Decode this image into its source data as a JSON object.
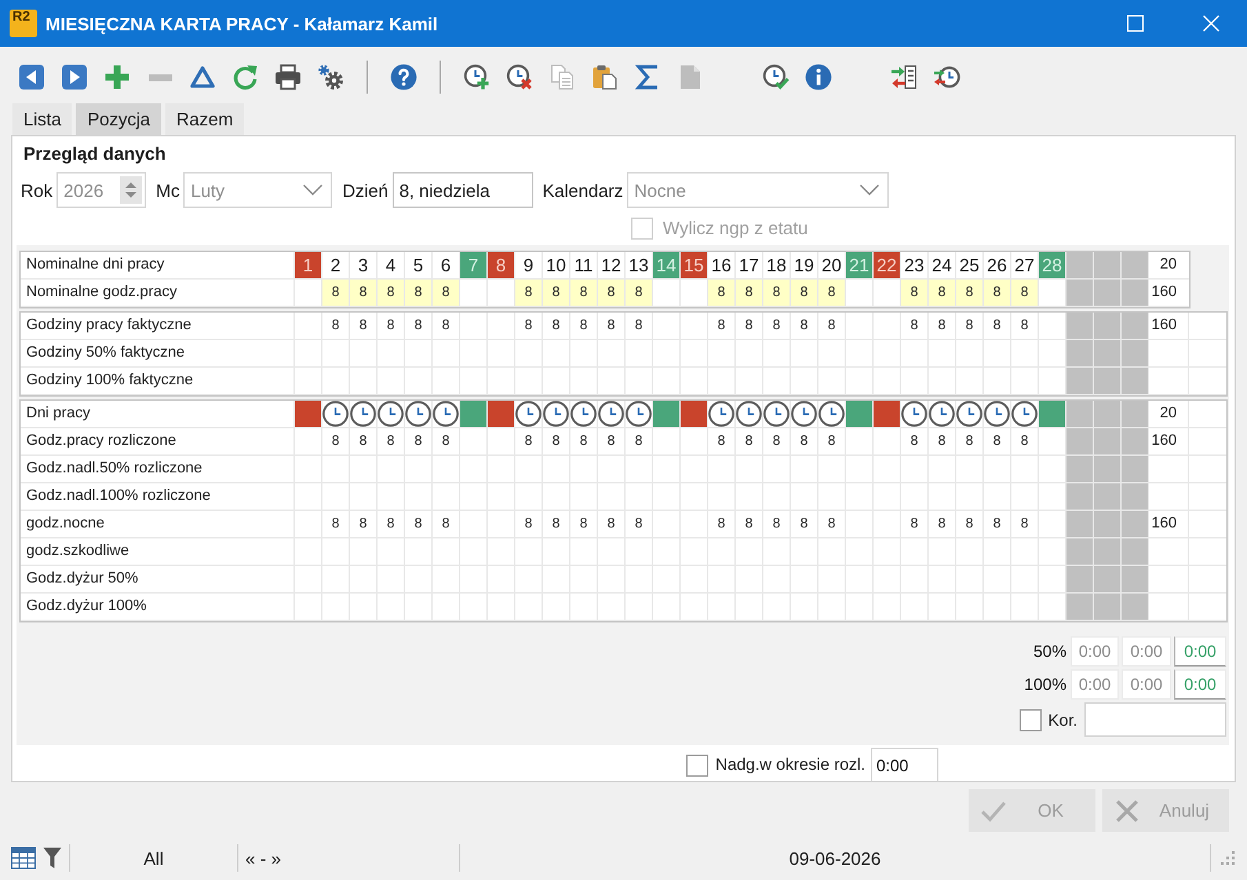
{
  "window": {
    "logo": "R2",
    "title": "MIESIĘCZNA KARTA PRACY - Kałamarz Kamil"
  },
  "toolbar": [
    {
      "disabled": false
    },
    {
      "disabled": false
    },
    {
      "disabled": false
    },
    {
      "disabled": true
    },
    {
      "disabled": false
    },
    {
      "disabled": false
    },
    {
      "disabled": false
    },
    {
      "disabled": false
    },
    {
      "disabled": false
    },
    {
      "disabled": false
    },
    {
      "disabled": false
    },
    {
      "disabled": true
    },
    {
      "disabled": false
    },
    {
      "disabled": false
    },
    {
      "disabled": true
    },
    {
      "disabled": false
    },
    {
      "disabled": false
    },
    {
      "disabled": false
    },
    {
      "disabled": false
    }
  ],
  "tabs": [
    {
      "label": "Lista",
      "selected": false
    },
    {
      "label": "Pozycja",
      "selected": true
    },
    {
      "label": "Razem",
      "selected": false
    }
  ],
  "form": {
    "title": "Przegląd danych",
    "fields": [
      {
        "kind": "spinner",
        "label": "Rok",
        "value": "2026",
        "disabled": true
      },
      {
        "kind": "dropdown",
        "label": "Mc",
        "value": "Luty",
        "disabled": true
      },
      {
        "kind": "text",
        "label": "Dzień",
        "value": "8, niedziela",
        "disabled": false
      },
      {
        "kind": "dropdown",
        "label": "Kalendarz",
        "value": "Nocne",
        "disabled": true
      }
    ],
    "checkbox": {
      "label": "Wylicz ngp z etatu",
      "checked": false,
      "disabled": true
    }
  },
  "grid": {
    "sections": [
      {
        "extra_column": false,
        "rows": [
          {
            "label": "Nominalne dni pracy",
            "kind": "days",
            "cells": [
              {
                "text": "1",
                "kind": "sunday"
              },
              {
                "text": "2",
                "kind": "work"
              },
              {
                "text": "3",
                "kind": "work"
              },
              {
                "text": "4",
                "kind": "work"
              },
              {
                "text": "5",
                "kind": "work"
              },
              {
                "text": "6",
                "kind": "work"
              },
              {
                "text": "7",
                "kind": "saturday"
              },
              {
                "text": "8",
                "kind": "sunday"
              },
              {
                "text": "9",
                "kind": "work"
              },
              {
                "text": "10",
                "kind": "work"
              },
              {
                "text": "11",
                "kind": "work"
              },
              {
                "text": "12",
                "kind": "work"
              },
              {
                "text": "13",
                "kind": "work"
              },
              {
                "text": "14",
                "kind": "saturday"
              },
              {
                "text": "15",
                "kind": "sunday"
              },
              {
                "text": "16",
                "kind": "work"
              },
              {
                "text": "17",
                "kind": "work"
              },
              {
                "text": "18",
                "kind": "work"
              },
              {
                "text": "19",
                "kind": "work"
              },
              {
                "text": "20",
                "kind": "work"
              },
              {
                "text": "21",
                "kind": "saturday"
              },
              {
                "text": "22",
                "kind": "sunday"
              },
              {
                "text": "23",
                "kind": "work"
              },
              {
                "text": "24",
                "kind": "work"
              },
              {
                "text": "25",
                "kind": "work"
              },
              {
                "text": "26",
                "kind": "work"
              },
              {
                "text": "27",
                "kind": "work"
              },
              {
                "text": "28",
                "kind": "saturday"
              }
            ],
            "total": "20"
          },
          {
            "label": "Nominalne godz.pracy",
            "kind": "hours",
            "highlight": true,
            "cells": [
              null,
              "8",
              "8",
              "8",
              "8",
              "8",
              null,
              null,
              "8",
              "8",
              "8",
              "8",
              "8",
              null,
              null,
              "8",
              "8",
              "8",
              "8",
              "8",
              null,
              null,
              "8",
              "8",
              "8",
              "8",
              "8",
              null
            ],
            "total": "160"
          }
        ]
      },
      {
        "extra_column": true,
        "rows": [
          {
            "label": "Godziny pracy faktyczne",
            "kind": "hours",
            "cells": [
              null,
              "8",
              "8",
              "8",
              "8",
              "8",
              null,
              null,
              "8",
              "8",
              "8",
              "8",
              "8",
              null,
              null,
              "8",
              "8",
              "8",
              "8",
              "8",
              null,
              null,
              "8",
              "8",
              "8",
              "8",
              "8",
              null
            ],
            "total": "160"
          },
          {
            "label": "Godziny 50% faktyczne",
            "kind": "hours"
          },
          {
            "label": "Godziny 100% faktyczne",
            "kind": "hours"
          }
        ]
      },
      {
        "extra_column": true,
        "rows": [
          {
            "label": "Dni pracy",
            "kind": "markers",
            "cells": [
              {
                "kind": "sunday"
              },
              {
                "kind": "work"
              },
              {
                "kind": "work"
              },
              {
                "kind": "work"
              },
              {
                "kind": "work"
              },
              {
                "kind": "work"
              },
              {
                "kind": "saturday"
              },
              {
                "kind": "sunday"
              },
              {
                "kind": "work"
              },
              {
                "kind": "work"
              },
              {
                "kind": "work"
              },
              {
                "kind": "work"
              },
              {
                "kind": "work"
              },
              {
                "kind": "saturday"
              },
              {
                "kind": "sunday"
              },
              {
                "kind": "work"
              },
              {
                "kind": "work"
              },
              {
                "kind": "work"
              },
              {
                "kind": "work"
              },
              {
                "kind": "work"
              },
              {
                "kind": "saturday"
              },
              {
                "kind": "sunday"
              },
              {
                "kind": "work"
              },
              {
                "kind": "work"
              },
              {
                "kind": "work"
              },
              {
                "kind": "work"
              },
              {
                "kind": "work"
              },
              {
                "kind": "saturday"
              }
            ],
            "total": "20"
          },
          {
            "label": "Godz.pracy rozliczone",
            "kind": "hours",
            "cells": [
              null,
              "8",
              "8",
              "8",
              "8",
              "8",
              null,
              null,
              "8",
              "8",
              "8",
              "8",
              "8",
              null,
              null,
              "8",
              "8",
              "8",
              "8",
              "8",
              null,
              null,
              "8",
              "8",
              "8",
              "8",
              "8",
              null
            ],
            "total": "160"
          },
          {
            "label": "Godz.nadl.50% rozliczone",
            "kind": "hours"
          },
          {
            "label": "Godz.nadl.100% rozliczone",
            "kind": "hours"
          },
          {
            "label": "godz.nocne",
            "kind": "hours",
            "cells": [
              null,
              "8",
              "8",
              "8",
              "8",
              "8",
              null,
              null,
              "8",
              "8",
              "8",
              "8",
              "8",
              null,
              null,
              "8",
              "8",
              "8",
              "8",
              "8",
              null,
              null,
              "8",
              "8",
              "8",
              "8",
              "8",
              null
            ],
            "total": "160"
          },
          {
            "label": "godz.szkodliwe",
            "kind": "hours"
          },
          {
            "label": "Godz.dyżur 50%",
            "kind": "hours"
          },
          {
            "label": "Godz.dyżur 100%",
            "kind": "hours"
          }
        ]
      }
    ]
  },
  "summary": {
    "rows": [
      {
        "label": "50%",
        "values": [
          "0:00",
          "0:00",
          "0:00"
        ]
      },
      {
        "label": "100%",
        "values": [
          "0:00",
          "0:00",
          "0:00"
        ]
      }
    ],
    "correction": {
      "label": "Kor.",
      "checked": false
    }
  },
  "overtime": {
    "label": "Nadg.w okresie rozl.",
    "checked": false,
    "value": "0:00"
  },
  "buttons": [
    {
      "kind": "ok",
      "label": "OK",
      "disabled": true
    },
    {
      "kind": "cancel",
      "label": "Anuluj",
      "disabled": true
    }
  ],
  "status_bar": {
    "filter": "All",
    "navigation": "« - »",
    "date": "09-06-2026"
  }
}
